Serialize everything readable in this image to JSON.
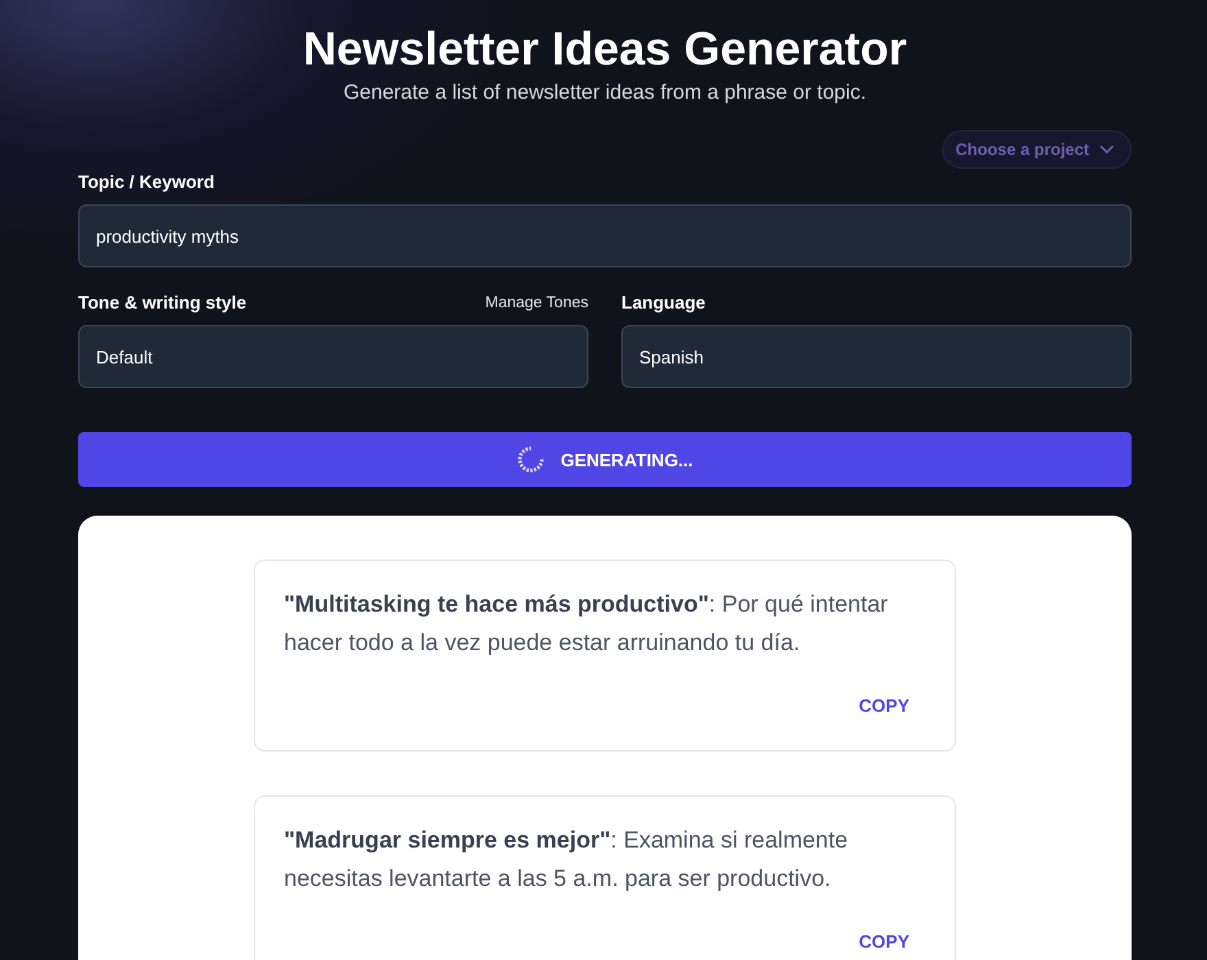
{
  "header": {
    "title": "Newsletter Ideas Generator",
    "subtitle": "Generate a list of newsletter ideas from a phrase or topic."
  },
  "project_selector": {
    "label": "Choose a project"
  },
  "form": {
    "topic": {
      "label": "Topic / Keyword",
      "value": "productivity myths"
    },
    "tone": {
      "label": "Tone & writing style",
      "link": "Manage Tones",
      "value": "Default"
    },
    "language": {
      "label": "Language",
      "value": "Spanish"
    }
  },
  "generate_button": {
    "label": "GENERATING...",
    "loading": true
  },
  "results": [
    {
      "text": "**\"Multitasking te hace más productivo\"**: Por qué intentar hacer todo a la vez puede estar arruinando tu día.",
      "action": "COPY"
    },
    {
      "text": "**\"Madrugar siempre es mejor\"**: Examina si realmente necesitas levantarte a las 5 a.m. para ser productivo.",
      "action": "COPY"
    }
  ]
}
